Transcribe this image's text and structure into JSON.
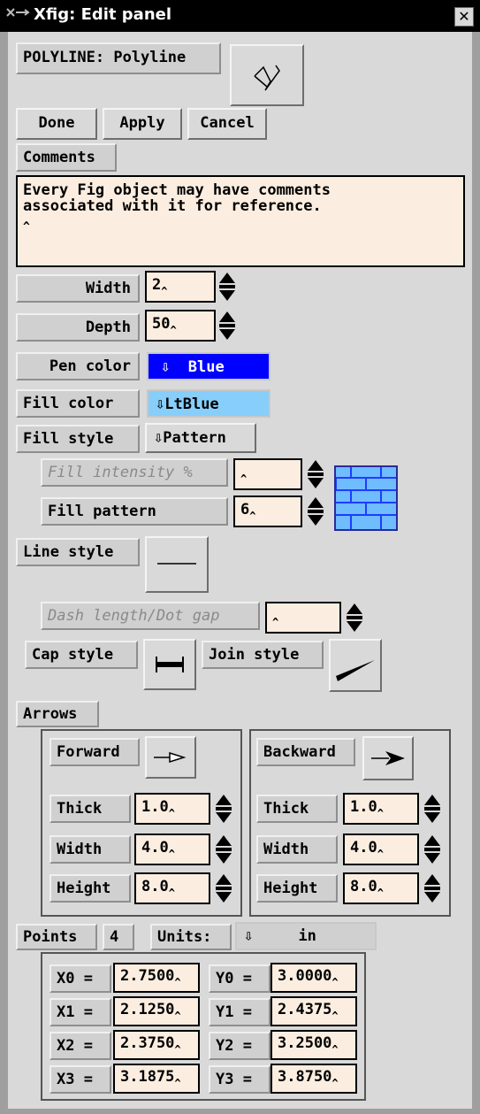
{
  "window": {
    "title": "Xfig: Edit panel",
    "close_symbol": "✕"
  },
  "header": {
    "object_label": "POLYLINE: Polyline"
  },
  "buttons": {
    "done": "Done",
    "apply": "Apply",
    "cancel": "Cancel"
  },
  "comments": {
    "label": "Comments",
    "text_line1": "Every Fig object may have comments",
    "text_line2": "associated with it for reference.",
    "cursor": "^"
  },
  "props": {
    "width_label": "Width",
    "width_value": "2",
    "depth_label": "Depth",
    "depth_value": "50",
    "pen_color_label": "Pen color",
    "pen_color_value": "Blue",
    "pen_color_hex": "#0000ff",
    "fill_color_label": "Fill color",
    "fill_color_value": "LtBlue",
    "fill_color_hex": "#87cefa",
    "fill_style_label": "Fill style",
    "fill_style_value": "Pattern",
    "fill_intensity_label": "Fill intensity %",
    "fill_intensity_value": "",
    "fill_pattern_label": "Fill pattern",
    "fill_pattern_value": "6",
    "line_style_label": "Line style",
    "dash_label": "Dash length/Dot gap",
    "dash_value": "",
    "cap_style_label": "Cap style",
    "join_style_label": "Join style"
  },
  "arrows": {
    "label": "Arrows",
    "forward": {
      "label": "Forward",
      "thick_label": "Thick",
      "thick": "1.0",
      "width_label": "Width",
      "width": "4.0",
      "height_label": "Height",
      "height": "8.0"
    },
    "backward": {
      "label": "Backward",
      "thick_label": "Thick",
      "thick": "1.0",
      "width_label": "Width",
      "width": "4.0",
      "height_label": "Height",
      "height": "8.0"
    }
  },
  "points": {
    "label": "Points",
    "count": "4",
    "units_label": "Units:",
    "units_value": "in",
    "rows": [
      {
        "xl": "X0 =",
        "x": "2.7500",
        "yl": "Y0 =",
        "y": "3.0000"
      },
      {
        "xl": "X1 =",
        "x": "2.1250",
        "yl": "Y1 =",
        "y": "2.4375"
      },
      {
        "xl": "X2 =",
        "x": "2.3750",
        "yl": "Y2 =",
        "y": "3.2500"
      },
      {
        "xl": "X3 =",
        "x": "3.1875",
        "yl": "Y3 =",
        "y": "3.8750"
      }
    ]
  }
}
